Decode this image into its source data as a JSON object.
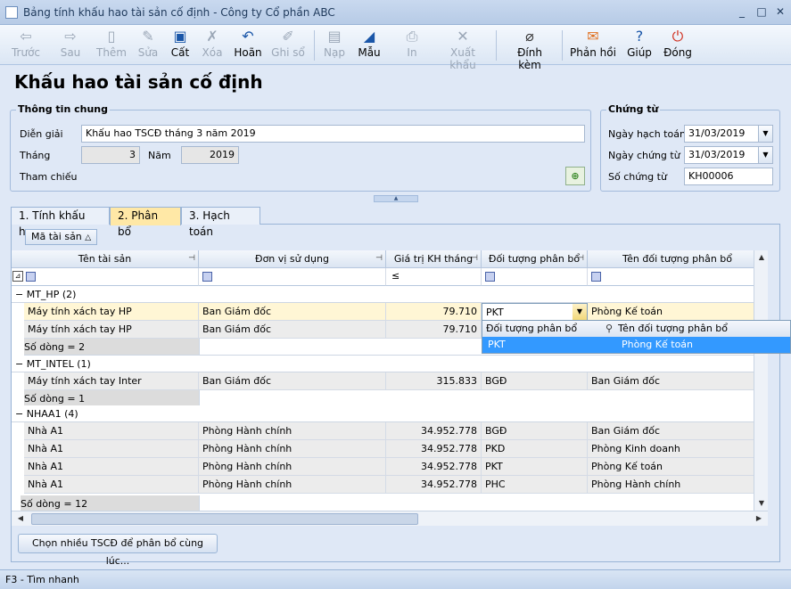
{
  "window": {
    "title": "Bảng tính khấu hao tài sản cố định - Công ty Cổ phần ABC",
    "min": "_",
    "max": "□",
    "close": "✕"
  },
  "toolbar": {
    "back": "Trước",
    "forward": "Sau",
    "add": "Thêm",
    "edit": "Sửa",
    "save": "Cất",
    "delete": "Xóa",
    "undo": "Hoãn",
    "post": "Ghi sổ",
    "load": "Nạp",
    "template": "Mẫu",
    "print": "In",
    "export": "Xuất khẩu",
    "attach": "Đính kèm",
    "feedback": "Phản hồi",
    "help": "Giúp",
    "close": "Đóng"
  },
  "page_title": "Khấu hao tài sản cố định",
  "general": {
    "title": "Thông tin chung",
    "desc_label": "Diễn giải",
    "desc_value": "Khấu hao TSCĐ tháng 3 năm 2019",
    "month_label": "Tháng",
    "month_value": "3",
    "year_label": "Năm",
    "year_value": "2019",
    "ref_label": "Tham chiếu"
  },
  "voucher": {
    "title": "Chứng từ",
    "post_date_label": "Ngày hạch toán",
    "post_date_value": "31/03/2019",
    "doc_date_label": "Ngày chứng từ",
    "doc_date_value": "31/03/2019",
    "doc_no_label": "Số chứng từ",
    "doc_no_value": "KH00006"
  },
  "tabs": [
    "1. Tính khấu hao",
    "2. Phân bổ",
    "3. Hạch toán"
  ],
  "groupby_chip": "Mã tài sản",
  "columns": [
    "Tên tài sản",
    "Đơn vị sử dụng",
    "Giá trị KH tháng",
    "Đối tượng phân bổ",
    "Tên đối tượng phân bổ"
  ],
  "filter_op": "≤",
  "groups": [
    {
      "header": "MT_HP (2)",
      "rows": [
        [
          "Máy tính xách tay HP",
          "Ban Giám đốc",
          "79.710",
          "PKT",
          "Phòng Kế toán"
        ],
        [
          "Máy tính xách tay HP",
          "Ban Giám đốc",
          "79.710",
          "",
          ""
        ]
      ],
      "summary": "Số dòng = 2"
    },
    {
      "header": "MT_INTEL (1)",
      "rows": [
        [
          "Máy tính xách tay Inter",
          "Ban Giám đốc",
          "315.833",
          "BGĐ",
          "Ban Giám đốc"
        ]
      ],
      "summary": "Số dòng = 1"
    },
    {
      "header": "NHAA1 (4)",
      "rows": [
        [
          "Nhà A1",
          "Phòng Hành chính",
          "34.952.778",
          "BGĐ",
          "Ban Giám đốc"
        ],
        [
          "Nhà A1",
          "Phòng Hành chính",
          "34.952.778",
          "PKD",
          "Phòng Kinh doanh"
        ],
        [
          "Nhà A1",
          "Phòng Hành chính",
          "34.952.778",
          "PKT",
          "Phòng Kế toán"
        ],
        [
          "Nhà A1",
          "Phòng Hành chính",
          "34.952.778",
          "PHC",
          "Phòng Hành chính"
        ]
      ],
      "summary": ""
    }
  ],
  "total_summary": "Số dòng = 12",
  "dropdown": {
    "col1": "Đối tượng phân bổ",
    "col2": "Tên đối tượng phân bổ",
    "sel_code": "PKT",
    "sel_name": "Phòng Kế toán"
  },
  "bottom_button": "Chọn nhiều TSCĐ để phân bổ cùng lúc...",
  "status": "F3 - Tìm nhanh"
}
